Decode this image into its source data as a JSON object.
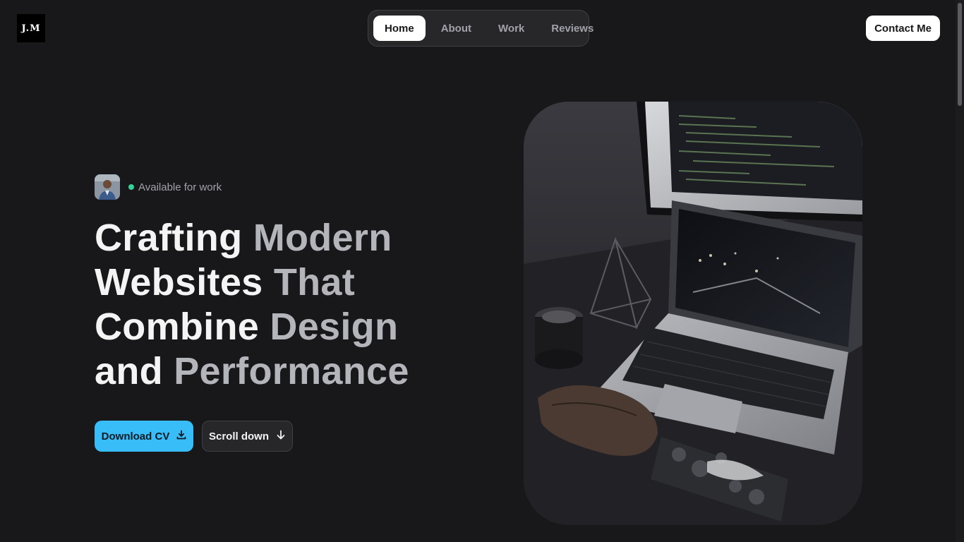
{
  "header": {
    "logo_text": "J.M",
    "nav": [
      {
        "label": "Home",
        "active": true
      },
      {
        "label": "About",
        "active": false
      },
      {
        "label": "Work",
        "active": false
      },
      {
        "label": "Reviews",
        "active": false
      }
    ],
    "contact_label": "Contact Me"
  },
  "hero": {
    "status": "Available for work",
    "status_color": "#34d399",
    "headline": [
      {
        "strong": "Crafting",
        "muted": "Modern"
      },
      {
        "strong": "Websites",
        "muted": "That"
      },
      {
        "strong": "Combine",
        "muted": "Design"
      },
      {
        "strong": "and",
        "muted": "Performance"
      }
    ],
    "download_label": "Download CV",
    "scroll_label": "Scroll down",
    "accent_color": "#38bdf8"
  },
  "icons": {
    "download": "download-icon",
    "scroll": "arrow-down-icon"
  }
}
